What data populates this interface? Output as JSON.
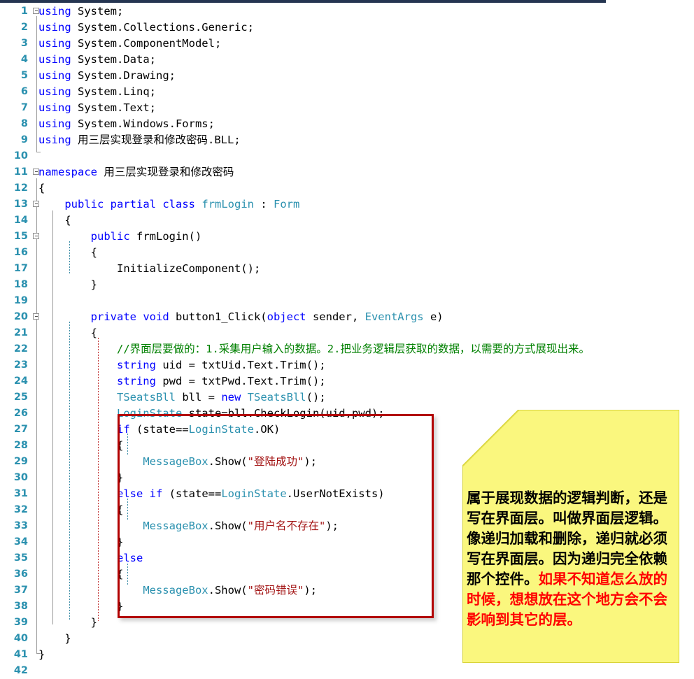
{
  "editor": {
    "name": "visual-studio-csharp-code-view",
    "language": "C#",
    "gutter_color": "#2B91AF",
    "colors": {
      "keyword": "#0000FF",
      "type": "#2B91AF",
      "string": "#A31515",
      "comment": "#008000",
      "plain": "#000000",
      "highlight_border": "#B20000",
      "note_background": "#FAF77E",
      "note_accent": "#FF0000"
    },
    "lines": [
      {
        "num": "1",
        "fold": true,
        "tokens": [
          {
            "t": "using",
            "c": "kw"
          },
          {
            "t": " System;",
            "c": "pln"
          }
        ]
      },
      {
        "num": "2",
        "fold": false,
        "tokens": [
          {
            "t": "using",
            "c": "kw"
          },
          {
            "t": " System.Collections.Generic;",
            "c": "pln"
          }
        ]
      },
      {
        "num": "3",
        "fold": false,
        "tokens": [
          {
            "t": "using",
            "c": "kw"
          },
          {
            "t": " System.ComponentModel;",
            "c": "pln"
          }
        ]
      },
      {
        "num": "4",
        "fold": false,
        "tokens": [
          {
            "t": "using",
            "c": "kw"
          },
          {
            "t": " System.Data;",
            "c": "pln"
          }
        ]
      },
      {
        "num": "5",
        "fold": false,
        "tokens": [
          {
            "t": "using",
            "c": "kw"
          },
          {
            "t": " System.Drawing;",
            "c": "pln"
          }
        ]
      },
      {
        "num": "6",
        "fold": false,
        "tokens": [
          {
            "t": "using",
            "c": "kw"
          },
          {
            "t": " System.Linq;",
            "c": "pln"
          }
        ]
      },
      {
        "num": "7",
        "fold": false,
        "tokens": [
          {
            "t": "using",
            "c": "kw"
          },
          {
            "t": " System.Text;",
            "c": "pln"
          }
        ]
      },
      {
        "num": "8",
        "fold": false,
        "tokens": [
          {
            "t": "using",
            "c": "kw"
          },
          {
            "t": " System.Windows.Forms;",
            "c": "pln"
          }
        ]
      },
      {
        "num": "9",
        "fold": false,
        "tokens": [
          {
            "t": "using",
            "c": "kw"
          },
          {
            "t": " 用三层实现登录和修改密码.BLL;",
            "c": "pln"
          }
        ]
      },
      {
        "num": "10",
        "fold": false,
        "tokens": []
      },
      {
        "num": "11",
        "fold": true,
        "tokens": [
          {
            "t": "namespace",
            "c": "kw"
          },
          {
            "t": " 用三层实现登录和修改密码",
            "c": "pln"
          }
        ]
      },
      {
        "num": "12",
        "fold": false,
        "tokens": [
          {
            "t": "{",
            "c": "pln"
          }
        ]
      },
      {
        "num": "13",
        "fold": true,
        "tokens": [
          {
            "t": "    ",
            "c": "pln"
          },
          {
            "t": "public",
            "c": "kw"
          },
          {
            "t": " ",
            "c": "pln"
          },
          {
            "t": "partial",
            "c": "kw"
          },
          {
            "t": " ",
            "c": "pln"
          },
          {
            "t": "class",
            "c": "kw"
          },
          {
            "t": " ",
            "c": "pln"
          },
          {
            "t": "frmLogin",
            "c": "typ"
          },
          {
            "t": " : ",
            "c": "pln"
          },
          {
            "t": "Form",
            "c": "typ"
          }
        ]
      },
      {
        "num": "14",
        "fold": false,
        "tokens": [
          {
            "t": "    {",
            "c": "pln"
          }
        ]
      },
      {
        "num": "15",
        "fold": true,
        "tokens": [
          {
            "t": "        ",
            "c": "pln"
          },
          {
            "t": "public",
            "c": "kw"
          },
          {
            "t": " frmLogin()",
            "c": "pln"
          }
        ]
      },
      {
        "num": "16",
        "fold": false,
        "tokens": [
          {
            "t": "        {",
            "c": "pln"
          }
        ]
      },
      {
        "num": "17",
        "fold": false,
        "tokens": [
          {
            "t": "            InitializeComponent();",
            "c": "pln"
          }
        ]
      },
      {
        "num": "18",
        "fold": false,
        "tokens": [
          {
            "t": "        }",
            "c": "pln"
          }
        ]
      },
      {
        "num": "19",
        "fold": false,
        "tokens": []
      },
      {
        "num": "20",
        "fold": true,
        "tokens": [
          {
            "t": "        ",
            "c": "pln"
          },
          {
            "t": "private",
            "c": "kw"
          },
          {
            "t": " ",
            "c": "pln"
          },
          {
            "t": "void",
            "c": "kw"
          },
          {
            "t": " button1_Click(",
            "c": "pln"
          },
          {
            "t": "object",
            "c": "kw"
          },
          {
            "t": " sender, ",
            "c": "pln"
          },
          {
            "t": "EventArgs",
            "c": "typ"
          },
          {
            "t": " e)",
            "c": "pln"
          }
        ]
      },
      {
        "num": "21",
        "fold": false,
        "tokens": [
          {
            "t": "        {",
            "c": "pln"
          }
        ]
      },
      {
        "num": "22",
        "fold": false,
        "tokens": [
          {
            "t": "            //界面层要做的：1.采集用户输入的数据。2.把业务逻辑层获取的数据，以需要的方式展现出来。",
            "c": "cmt"
          }
        ]
      },
      {
        "num": "23",
        "fold": false,
        "tokens": [
          {
            "t": "            ",
            "c": "pln"
          },
          {
            "t": "string",
            "c": "kw"
          },
          {
            "t": " uid = txtUid.Text.Trim();",
            "c": "pln"
          }
        ]
      },
      {
        "num": "24",
        "fold": false,
        "tokens": [
          {
            "t": "            ",
            "c": "pln"
          },
          {
            "t": "string",
            "c": "kw"
          },
          {
            "t": " pwd = txtPwd.Text.Trim();",
            "c": "pln"
          }
        ]
      },
      {
        "num": "25",
        "fold": false,
        "tokens": [
          {
            "t": "            ",
            "c": "pln"
          },
          {
            "t": "TSeatsBll",
            "c": "typ"
          },
          {
            "t": " bll = ",
            "c": "pln"
          },
          {
            "t": "new",
            "c": "kw"
          },
          {
            "t": " ",
            "c": "pln"
          },
          {
            "t": "TSeatsBll",
            "c": "typ"
          },
          {
            "t": "();",
            "c": "pln"
          }
        ]
      },
      {
        "num": "26",
        "fold": false,
        "tokens": [
          {
            "t": "            ",
            "c": "pln"
          },
          {
            "t": "LoginState",
            "c": "typ"
          },
          {
            "t": " state=bll.CheckLogin(uid,pwd);",
            "c": "pln"
          }
        ]
      },
      {
        "num": "27",
        "fold": false,
        "tokens": [
          {
            "t": "            ",
            "c": "pln"
          },
          {
            "t": "if",
            "c": "kw"
          },
          {
            "t": " (state==",
            "c": "pln"
          },
          {
            "t": "LoginState",
            "c": "typ"
          },
          {
            "t": ".OK)",
            "c": "pln"
          }
        ]
      },
      {
        "num": "28",
        "fold": false,
        "tokens": [
          {
            "t": "            {",
            "c": "pln"
          }
        ]
      },
      {
        "num": "29",
        "fold": false,
        "tokens": [
          {
            "t": "                ",
            "c": "pln"
          },
          {
            "t": "MessageBox",
            "c": "typ"
          },
          {
            "t": ".Show(",
            "c": "pln"
          },
          {
            "t": "\"登陆成功\"",
            "c": "str"
          },
          {
            "t": ");",
            "c": "pln"
          }
        ]
      },
      {
        "num": "30",
        "fold": false,
        "tokens": [
          {
            "t": "            }",
            "c": "pln"
          }
        ]
      },
      {
        "num": "31",
        "fold": false,
        "tokens": [
          {
            "t": "            ",
            "c": "pln"
          },
          {
            "t": "else",
            "c": "kw"
          },
          {
            "t": " ",
            "c": "pln"
          },
          {
            "t": "if",
            "c": "kw"
          },
          {
            "t": " (state==",
            "c": "pln"
          },
          {
            "t": "LoginState",
            "c": "typ"
          },
          {
            "t": ".UserNotExists)",
            "c": "pln"
          }
        ]
      },
      {
        "num": "32",
        "fold": false,
        "tokens": [
          {
            "t": "            {",
            "c": "pln"
          }
        ]
      },
      {
        "num": "33",
        "fold": false,
        "tokens": [
          {
            "t": "                ",
            "c": "pln"
          },
          {
            "t": "MessageBox",
            "c": "typ"
          },
          {
            "t": ".Show(",
            "c": "pln"
          },
          {
            "t": "\"用户名不存在\"",
            "c": "str"
          },
          {
            "t": ");",
            "c": "pln"
          }
        ]
      },
      {
        "num": "34",
        "fold": false,
        "tokens": [
          {
            "t": "            }",
            "c": "pln"
          }
        ]
      },
      {
        "num": "35",
        "fold": false,
        "tokens": [
          {
            "t": "            ",
            "c": "pln"
          },
          {
            "t": "else",
            "c": "kw"
          }
        ]
      },
      {
        "num": "36",
        "fold": false,
        "tokens": [
          {
            "t": "            {",
            "c": "pln"
          }
        ]
      },
      {
        "num": "37",
        "fold": false,
        "tokens": [
          {
            "t": "                ",
            "c": "pln"
          },
          {
            "t": "MessageBox",
            "c": "typ"
          },
          {
            "t": ".Show(",
            "c": "pln"
          },
          {
            "t": "\"密码错误\"",
            "c": "str"
          },
          {
            "t": ");",
            "c": "pln"
          }
        ]
      },
      {
        "num": "38",
        "fold": false,
        "tokens": [
          {
            "t": "            }",
            "c": "pln"
          }
        ]
      },
      {
        "num": "39",
        "fold": false,
        "tokens": [
          {
            "t": "        }",
            "c": "pln"
          }
        ]
      },
      {
        "num": "40",
        "fold": false,
        "tokens": [
          {
            "t": "    }",
            "c": "pln"
          }
        ]
      },
      {
        "num": "41",
        "fold": false,
        "tokens": [
          {
            "t": "}",
            "c": "pln"
          }
        ]
      },
      {
        "num": "42",
        "fold": false,
        "tokens": []
      }
    ]
  },
  "annotation": {
    "sticky_note": {
      "segments": [
        {
          "text": "属于展现数据的逻辑判断，还是写在界面层。叫做界面层逻辑。像递归加载和删除，递归就必须写在界面层。因为递归完全依赖那个控件。",
          "color": "black"
        },
        {
          "text": "如果不知道怎么放的时候，想想放在这个地方会不会影响到其它的层。",
          "color": "red"
        }
      ]
    },
    "highlight_box": {
      "label": "if-else-block-highlight",
      "covers_lines": "27-38"
    }
  }
}
